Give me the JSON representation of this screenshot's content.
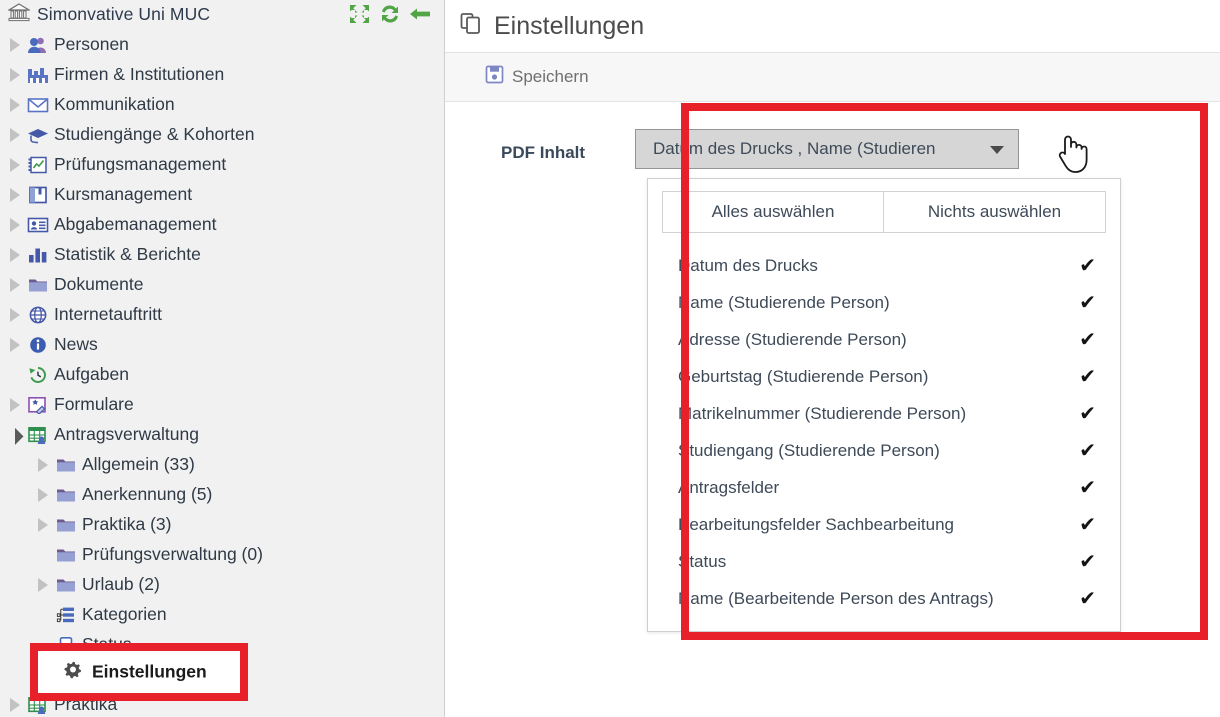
{
  "sidebar": {
    "org_title": "Simonvative Uni MUC",
    "header_icons": [
      {
        "name": "collapse-all-icon",
        "label": "Alles einklappen"
      },
      {
        "name": "refresh-icon",
        "label": "Aktualisieren"
      },
      {
        "name": "back-arrow-icon",
        "label": "Zurück"
      }
    ],
    "items": [
      {
        "label": "Personen",
        "icon": "people-icon",
        "level": 1,
        "twisty": "collapsed"
      },
      {
        "label": "Firmen & Institutionen",
        "icon": "factory-icon",
        "level": 1,
        "twisty": "collapsed"
      },
      {
        "label": "Kommunikation",
        "icon": "envelope-icon",
        "level": 1,
        "twisty": "collapsed"
      },
      {
        "label": "Studiengänge & Kohorten",
        "icon": "graduation-cap-icon",
        "level": 1,
        "twisty": "collapsed"
      },
      {
        "label": "Prüfungsmanagement",
        "icon": "exam-chart-icon",
        "level": 1,
        "twisty": "collapsed"
      },
      {
        "label": "Kursmanagement",
        "icon": "book-icon",
        "level": 1,
        "twisty": "collapsed"
      },
      {
        "label": "Abgabemanagement",
        "icon": "id-card-icon",
        "level": 1,
        "twisty": "collapsed"
      },
      {
        "label": "Statistik & Berichte",
        "icon": "bar-chart-icon",
        "level": 1,
        "twisty": "collapsed"
      },
      {
        "label": "Dokumente",
        "icon": "folder-icon",
        "level": 1,
        "twisty": "collapsed"
      },
      {
        "label": "Internetauftritt",
        "icon": "globe-icon",
        "level": 1,
        "twisty": "collapsed"
      },
      {
        "label": "News",
        "icon": "info-icon",
        "level": 1,
        "twisty": "collapsed"
      },
      {
        "label": "Aufgaben",
        "icon": "history-clock-icon",
        "level": 1,
        "twisty": "none"
      },
      {
        "label": "Formulare",
        "icon": "form-wizard-icon",
        "level": 1,
        "twisty": "collapsed"
      },
      {
        "label": "Antragsverwaltung",
        "icon": "application-table-icon",
        "level": 1,
        "twisty": "expanded"
      },
      {
        "label": "Allgemein (33)",
        "icon": "folder-icon",
        "level": 2,
        "twisty": "collapsed"
      },
      {
        "label": "Anerkennung (5)",
        "icon": "folder-icon",
        "level": 2,
        "twisty": "collapsed"
      },
      {
        "label": "Praktika (3)",
        "icon": "folder-icon",
        "level": 2,
        "twisty": "collapsed"
      },
      {
        "label": "Prüfungsverwaltung (0)",
        "icon": "folder-icon",
        "level": 2,
        "twisty": "none"
      },
      {
        "label": "Urlaub (2)",
        "icon": "folder-icon",
        "level": 2,
        "twisty": "collapsed"
      },
      {
        "label": "Kategorien",
        "icon": "sitemap-icon",
        "level": 2,
        "twisty": "none"
      },
      {
        "label": "Status",
        "icon": "status-boxes-icon",
        "level": 2,
        "twisty": "none"
      },
      {
        "label": "Einstellungen",
        "icon": "gear-icon",
        "level": 2,
        "twisty": "none"
      },
      {
        "label": "Praktika",
        "icon": "internship-table-icon",
        "level": 1,
        "twisty": "collapsed"
      }
    ],
    "highlighted_item": {
      "label": "Einstellungen",
      "icon": "gear-icon"
    }
  },
  "main": {
    "page_title": "Einstellungen",
    "page_title_icon": "copy-pages-icon",
    "toolbar": {
      "save_label": "Speichern",
      "save_icon": "floppy-disk-save-icon"
    },
    "form": {
      "pdf_content_label": "PDF Inhalt",
      "multiselect": {
        "button_value": "Datum des Drucks , Name (Studierende Person) , Adresse (Studierende Person)",
        "button_display": "Datum des Drucks , Name (Studieren",
        "caret_icon": "chevron-down-icon",
        "select_all_label": "Alles auswählen",
        "select_none_label": "Nichts auswählen",
        "options": [
          {
            "label": "Datum des Drucks",
            "checked": true
          },
          {
            "label": "Name (Studierende Person)",
            "checked": true
          },
          {
            "label": "Adresse (Studierende Person)",
            "checked": true
          },
          {
            "label": "Geburtstag (Studierende Person)",
            "checked": true
          },
          {
            "label": "Matrikelnummer (Studierende Person)",
            "checked": true
          },
          {
            "label": "Studiengang (Studierende Person)",
            "checked": true
          },
          {
            "label": "Antragsfelder",
            "checked": true
          },
          {
            "label": "Bearbeitungsfelder Sachbearbeitung",
            "checked": true
          },
          {
            "label": "Status",
            "checked": true
          },
          {
            "label": "Name (Bearbeitende Person des Antrags)",
            "checked": true
          }
        ],
        "check_glyph": "✔"
      }
    }
  },
  "annotations": {
    "highlight_color": "#e8202a",
    "boxes": [
      {
        "name": "sidebar-einstellungen-highlight"
      },
      {
        "name": "pdf-content-dropdown-highlight"
      }
    ]
  },
  "cursor": {
    "type": "pointing-hand"
  }
}
